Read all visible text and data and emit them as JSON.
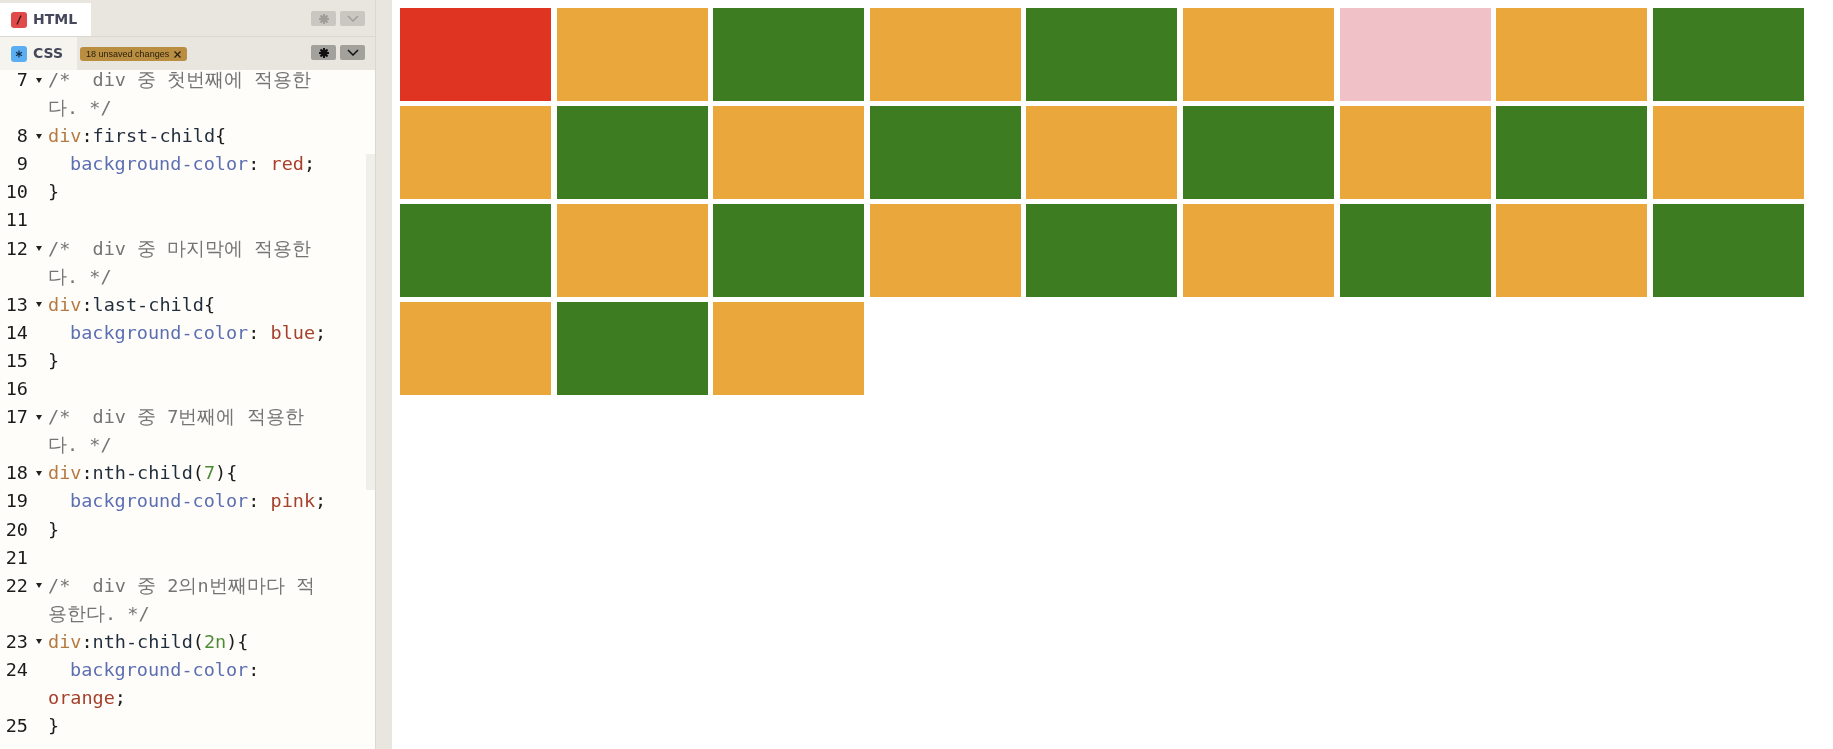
{
  "panels": [
    {
      "kind": "html",
      "label": "HTML",
      "expanded": false
    },
    {
      "kind": "css",
      "label": "CSS",
      "expanded": true,
      "badge": "18 unsaved changes",
      "lines": [
        {
          "number": "7",
          "foldable": true,
          "rows": [
            {
              "indent": false,
              "tokens": [
                {
                  "kind": "comment",
                  "text": "/*  div 중 첫번째에 적용한"
                }
              ]
            },
            {
              "indent": false,
              "tokens": [
                {
                  "kind": "comment",
                  "text": "다. */"
                }
              ]
            }
          ]
        },
        {
          "number": "8",
          "foldable": true,
          "rows": [
            {
              "indent": false,
              "tokens": [
                {
                  "kind": "tag",
                  "text": "div"
                },
                {
                  "kind": "punct",
                  "text": ":"
                },
                {
                  "kind": "pseudo",
                  "text": "first-child"
                },
                {
                  "kind": "punct",
                  "text": "{"
                }
              ]
            }
          ]
        },
        {
          "number": "9",
          "foldable": false,
          "rows": [
            {
              "indent": true,
              "tokens": [
                {
                  "kind": "property",
                  "text": "background-color"
                },
                {
                  "kind": "punct",
                  "text": ": "
                },
                {
                  "kind": "value",
                  "text": "red"
                },
                {
                  "kind": "punct",
                  "text": ";"
                }
              ]
            }
          ]
        },
        {
          "number": "10",
          "foldable": false,
          "rows": [
            {
              "indent": false,
              "tokens": [
                {
                  "kind": "punct",
                  "text": "}"
                }
              ]
            }
          ]
        },
        {
          "number": "11",
          "foldable": false
        },
        {
          "number": "12",
          "foldable": true,
          "rows": [
            {
              "indent": false,
              "tokens": [
                {
                  "kind": "comment",
                  "text": "/*  div 중 마지막에 적용한"
                }
              ]
            },
            {
              "indent": false,
              "tokens": [
                {
                  "kind": "comment",
                  "text": "다. */"
                }
              ]
            }
          ]
        },
        {
          "number": "13",
          "foldable": true,
          "rows": [
            {
              "indent": false,
              "tokens": [
                {
                  "kind": "tag",
                  "text": "div"
                },
                {
                  "kind": "punct",
                  "text": ":"
                },
                {
                  "kind": "pseudo",
                  "text": "last-child"
                },
                {
                  "kind": "punct",
                  "text": "{"
                }
              ]
            }
          ]
        },
        {
          "number": "14",
          "foldable": false,
          "rows": [
            {
              "indent": true,
              "tokens": [
                {
                  "kind": "property",
                  "text": "background-color"
                },
                {
                  "kind": "punct",
                  "text": ": "
                },
                {
                  "kind": "value",
                  "text": "blue"
                },
                {
                  "kind": "punct",
                  "text": ";"
                }
              ]
            }
          ]
        },
        {
          "number": "15",
          "foldable": false,
          "rows": [
            {
              "indent": false,
              "tokens": [
                {
                  "kind": "punct",
                  "text": "}"
                }
              ]
            }
          ]
        },
        {
          "number": "16",
          "foldable": false
        },
        {
          "number": "17",
          "foldable": true,
          "rows": [
            {
              "indent": false,
              "tokens": [
                {
                  "kind": "comment",
                  "text": "/*  div 중 7번째에 적용한"
                }
              ]
            },
            {
              "indent": false,
              "tokens": [
                {
                  "kind": "comment",
                  "text": "다. */"
                }
              ]
            }
          ]
        },
        {
          "number": "18",
          "foldable": true,
          "rows": [
            {
              "indent": false,
              "tokens": [
                {
                  "kind": "tag",
                  "text": "div"
                },
                {
                  "kind": "punct",
                  "text": ":"
                },
                {
                  "kind": "pseudo",
                  "text": "nth-child"
                },
                {
                  "kind": "punct",
                  "text": "("
                },
                {
                  "kind": "number",
                  "text": "7"
                },
                {
                  "kind": "punct",
                  "text": "){"
                }
              ]
            }
          ]
        },
        {
          "number": "19",
          "foldable": false,
          "rows": [
            {
              "indent": true,
              "tokens": [
                {
                  "kind": "property",
                  "text": "background-color"
                },
                {
                  "kind": "punct",
                  "text": ": "
                },
                {
                  "kind": "value",
                  "text": "pink"
                },
                {
                  "kind": "punct",
                  "text": ";"
                }
              ]
            }
          ]
        },
        {
          "number": "20",
          "foldable": false,
          "rows": [
            {
              "indent": false,
              "tokens": [
                {
                  "kind": "punct",
                  "text": "}"
                }
              ]
            }
          ]
        },
        {
          "number": "21",
          "foldable": false
        },
        {
          "number": "22",
          "foldable": true,
          "rows": [
            {
              "indent": false,
              "tokens": [
                {
                  "kind": "comment",
                  "text": "/*  div 중 2의n번째마다 적"
                }
              ]
            },
            {
              "indent": false,
              "tokens": [
                {
                  "kind": "comment",
                  "text": "용한다. */"
                }
              ]
            }
          ]
        },
        {
          "number": "23",
          "foldable": true,
          "rows": [
            {
              "indent": false,
              "tokens": [
                {
                  "kind": "tag",
                  "text": "div"
                },
                {
                  "kind": "punct",
                  "text": ":"
                },
                {
                  "kind": "pseudo",
                  "text": "nth-child"
                },
                {
                  "kind": "punct",
                  "text": "("
                },
                {
                  "kind": "number",
                  "text": "2n"
                },
                {
                  "kind": "punct",
                  "text": "){"
                }
              ]
            }
          ]
        },
        {
          "number": "24",
          "foldable": false,
          "rows": [
            {
              "indent": true,
              "tokens": [
                {
                  "kind": "property",
                  "text": "background-color"
                },
                {
                  "kind": "punct",
                  "text": ":"
                }
              ]
            },
            {
              "indent": false,
              "tokens": [
                {
                  "kind": "value",
                  "text": "orange"
                },
                {
                  "kind": "punct",
                  "text": ";"
                }
              ]
            }
          ]
        },
        {
          "number": "25",
          "foldable": false,
          "rows": [
            {
              "indent": false,
              "tokens": [
                {
                  "kind": "punct",
                  "text": "}"
                }
              ]
            }
          ]
        }
      ]
    }
  ],
  "preview": {
    "tiles": [
      {
        "color": "#df3422"
      },
      {
        "color": "#eaa73c"
      },
      {
        "color": "#3e7c22"
      },
      {
        "color": "#eaa73c"
      },
      {
        "color": "#3e7c22"
      },
      {
        "color": "#eaa73c"
      },
      {
        "color": "#f0c2c8"
      },
      {
        "color": "#eaa73c"
      },
      {
        "color": "#3e7c22"
      },
      {
        "color": "#eaa73c"
      },
      {
        "color": "#3e7c22"
      },
      {
        "color": "#eaa73c"
      },
      {
        "color": "#3e7c22"
      },
      {
        "color": "#eaa73c"
      },
      {
        "color": "#3e7c22"
      },
      {
        "color": "#eaa73c"
      },
      {
        "color": "#3e7c22"
      },
      {
        "color": "#eaa73c"
      },
      {
        "color": "#3e7c22"
      },
      {
        "color": "#eaa73c"
      },
      {
        "color": "#3e7c22"
      },
      {
        "color": "#eaa73c"
      },
      {
        "color": "#3e7c22"
      },
      {
        "color": "#eaa73c"
      },
      {
        "color": "#3e7c22"
      },
      {
        "color": "#eaa73c"
      },
      {
        "color": "#3e7c22"
      },
      {
        "color": "#eaa73c"
      },
      {
        "color": "#3e7c22"
      },
      {
        "color": "#eaa73c"
      }
    ]
  }
}
